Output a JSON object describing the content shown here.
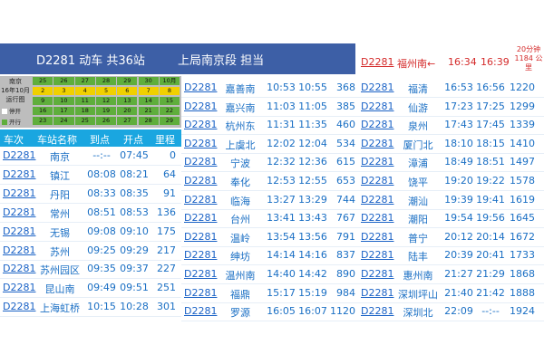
{
  "header": {
    "train_title": "D2281 动车 共36站",
    "bureau": "上局南京段 担当"
  },
  "calendar": {
    "label_line1": "南京",
    "label_line2": "16年10月",
    "label_line3": "运行图",
    "legend_stop": "停开",
    "legend_run": "开行",
    "rows": [
      [
        "25",
        "26",
        "27",
        "28",
        "29",
        "30",
        "10月"
      ],
      [
        "2",
        "3",
        "4",
        "5",
        "6",
        "7",
        "8"
      ],
      [
        "9",
        "10",
        "11",
        "12",
        "13",
        "14",
        "15"
      ],
      [
        "16",
        "17",
        "18",
        "19",
        "20",
        "21",
        "22"
      ],
      [
        "23",
        "24",
        "25",
        "26",
        "27",
        "28",
        "29"
      ]
    ],
    "colors": {
      "run": "#5fae3c",
      "stop_highlight": "#f0d000"
    }
  },
  "table_header": {
    "train": "车次",
    "station": "车站名称",
    "arrive": "到点",
    "depart": "开点",
    "mileage": "里程"
  },
  "right_header": {
    "train": "D2281",
    "station": "福州南←",
    "arrive": "16:34",
    "depart": "16:39",
    "note": "20分钟",
    "mileage": "1184 公里"
  },
  "col1": [
    {
      "train": "D2281",
      "station": "南京",
      "arrive": "--:--",
      "depart": "07:45",
      "km": "0"
    },
    {
      "train": "D2281",
      "station": "镇江",
      "arrive": "08:08",
      "depart": "08:21",
      "km": "64"
    },
    {
      "train": "D2281",
      "station": "丹阳",
      "arrive": "08:33",
      "depart": "08:35",
      "km": "91"
    },
    {
      "train": "D2281",
      "station": "常州",
      "arrive": "08:51",
      "depart": "08:53",
      "km": "136"
    },
    {
      "train": "D2281",
      "station": "无锡",
      "arrive": "09:08",
      "depart": "09:10",
      "km": "175"
    },
    {
      "train": "D2281",
      "station": "苏州",
      "arrive": "09:25",
      "depart": "09:29",
      "km": "217"
    },
    {
      "train": "D2281",
      "station": "苏州园区",
      "arrive": "09:35",
      "depart": "09:37",
      "km": "227"
    },
    {
      "train": "D2281",
      "station": "昆山南",
      "arrive": "09:49",
      "depart": "09:51",
      "km": "251"
    },
    {
      "train": "D2281",
      "station": "上海虹桥",
      "arrive": "10:15",
      "depart": "10:28",
      "km": "301"
    }
  ],
  "col2": [
    {
      "train": "D2281",
      "station": "嘉善南",
      "arrive": "10:53",
      "depart": "10:55",
      "km": "368"
    },
    {
      "train": "D2281",
      "station": "嘉兴南",
      "arrive": "11:03",
      "depart": "11:05",
      "km": "385"
    },
    {
      "train": "D2281",
      "station": "杭州东",
      "arrive": "11:31",
      "depart": "11:35",
      "km": "460"
    },
    {
      "train": "D2281",
      "station": "上虞北",
      "arrive": "12:02",
      "depart": "12:04",
      "km": "534"
    },
    {
      "train": "D2281",
      "station": "宁波",
      "arrive": "12:32",
      "depart": "12:36",
      "km": "615"
    },
    {
      "train": "D2281",
      "station": "奉化",
      "arrive": "12:53",
      "depart": "12:55",
      "km": "653"
    },
    {
      "train": "D2281",
      "station": "临海",
      "arrive": "13:27",
      "depart": "13:29",
      "km": "744"
    },
    {
      "train": "D2281",
      "station": "台州",
      "arrive": "13:41",
      "depart": "13:43",
      "km": "767"
    },
    {
      "train": "D2281",
      "station": "温岭",
      "arrive": "13:54",
      "depart": "13:56",
      "km": "791"
    },
    {
      "train": "D2281",
      "station": "绅坊",
      "arrive": "14:14",
      "depart": "14:16",
      "km": "837"
    },
    {
      "train": "D2281",
      "station": "温州南",
      "arrive": "14:40",
      "depart": "14:42",
      "km": "890"
    },
    {
      "train": "D2281",
      "station": "福鼎",
      "arrive": "15:17",
      "depart": "15:19",
      "km": "984"
    },
    {
      "train": "D2281",
      "station": "罗源",
      "arrive": "16:05",
      "depart": "16:07",
      "km": "1120"
    }
  ],
  "col3": [
    {
      "train": "D2281",
      "station": "福清",
      "arrive": "16:53",
      "depart": "16:56",
      "km": "1220"
    },
    {
      "train": "D2281",
      "station": "仙游",
      "arrive": "17:23",
      "depart": "17:25",
      "km": "1299"
    },
    {
      "train": "D2281",
      "station": "泉州",
      "arrive": "17:43",
      "depart": "17:45",
      "km": "1339"
    },
    {
      "train": "D2281",
      "station": "厦门北",
      "arrive": "18:10",
      "depart": "18:15",
      "km": "1410"
    },
    {
      "train": "D2281",
      "station": "漳浦",
      "arrive": "18:49",
      "depart": "18:51",
      "km": "1497"
    },
    {
      "train": "D2281",
      "station": "饶平",
      "arrive": "19:20",
      "depart": "19:22",
      "km": "1578"
    },
    {
      "train": "D2281",
      "station": "潮汕",
      "arrive": "19:39",
      "depart": "19:41",
      "km": "1619"
    },
    {
      "train": "D2281",
      "station": "潮阳",
      "arrive": "19:54",
      "depart": "19:56",
      "km": "1645"
    },
    {
      "train": "D2281",
      "station": "普宁",
      "arrive": "20:12",
      "depart": "20:14",
      "km": "1672"
    },
    {
      "train": "D2281",
      "station": "陆丰",
      "arrive": "20:39",
      "depart": "20:41",
      "km": "1733"
    },
    {
      "train": "D2281",
      "station": "惠州南",
      "arrive": "21:27",
      "depart": "21:29",
      "km": "1868"
    },
    {
      "train": "D2281",
      "station": "深圳坪山",
      "arrive": "21:40",
      "depart": "21:42",
      "km": "1888"
    },
    {
      "train": "D2281",
      "station": "深圳北",
      "arrive": "22:09",
      "depart": "--:--",
      "km": "1924"
    }
  ]
}
